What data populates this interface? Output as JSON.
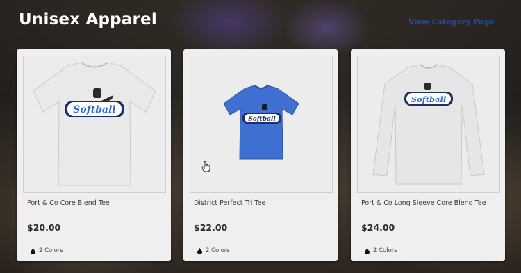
{
  "header": {
    "title": "Unisex Apparel",
    "category_link": "View Category Page"
  },
  "products": [
    {
      "name": "Port & Co Core Blend Tee",
      "price": "$20.00",
      "colors": "2 Colors",
      "shirt_color": "#e9e9e9",
      "sleeve": "short"
    },
    {
      "name": "District Perfect Tri Tee",
      "price": "$22.00",
      "colors": "2 Colors",
      "shirt_color": "#3f6fd0",
      "sleeve": "short"
    },
    {
      "name": "Port & Co Long Sleeve Core Blend Tee",
      "price": "$24.00",
      "colors": "2 Colors",
      "shirt_color": "#e6e6e6",
      "sleeve": "long"
    }
  ],
  "graphic_text": "Softball",
  "colors": {
    "link": "#1f4b9c",
    "title": "#ffffff"
  }
}
